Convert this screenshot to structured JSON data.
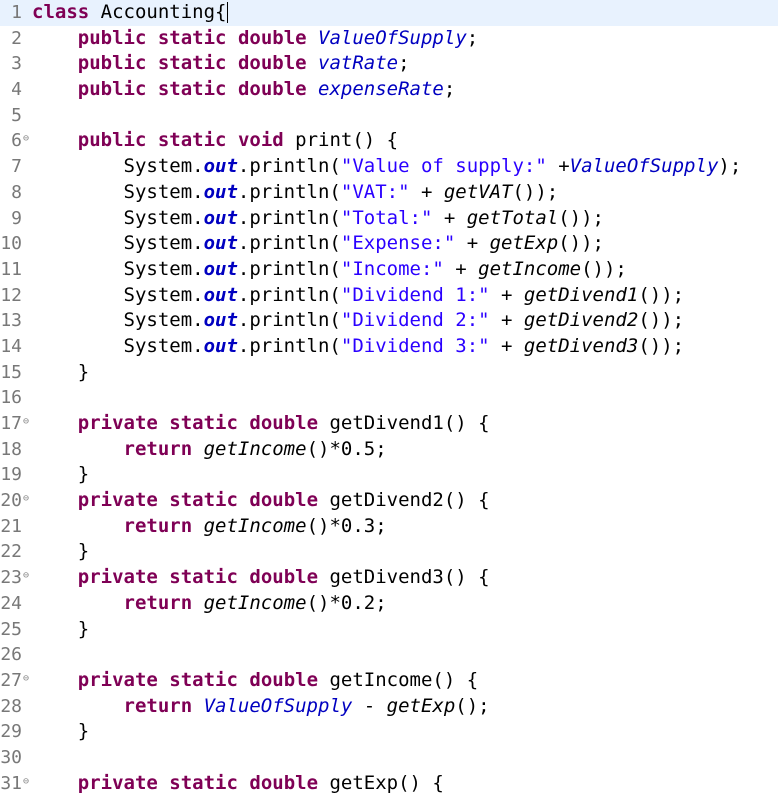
{
  "editor": {
    "lines": [
      {
        "n": "1",
        "fold": false,
        "current": true,
        "tokens": [
          {
            "t": "class",
            "s": "kw"
          },
          {
            "t": " Accounting{",
            "s": "plain"
          }
        ]
      },
      {
        "n": "2",
        "fold": false,
        "tokens": [
          {
            "t": "    ",
            "s": "plain"
          },
          {
            "t": "public",
            "s": "kw"
          },
          {
            "t": " ",
            "s": "plain"
          },
          {
            "t": "static",
            "s": "kw"
          },
          {
            "t": " ",
            "s": "plain"
          },
          {
            "t": "double",
            "s": "kw"
          },
          {
            "t": " ",
            "s": "plain"
          },
          {
            "t": "ValueOfSupply",
            "s": "field"
          },
          {
            "t": ";",
            "s": "plain"
          }
        ]
      },
      {
        "n": "3",
        "fold": false,
        "tokens": [
          {
            "t": "    ",
            "s": "plain"
          },
          {
            "t": "public",
            "s": "kw"
          },
          {
            "t": " ",
            "s": "plain"
          },
          {
            "t": "static",
            "s": "kw"
          },
          {
            "t": " ",
            "s": "plain"
          },
          {
            "t": "double",
            "s": "kw"
          },
          {
            "t": " ",
            "s": "plain"
          },
          {
            "t": "vatRate",
            "s": "field"
          },
          {
            "t": ";",
            "s": "plain"
          }
        ]
      },
      {
        "n": "4",
        "fold": false,
        "tokens": [
          {
            "t": "    ",
            "s": "plain"
          },
          {
            "t": "public",
            "s": "kw"
          },
          {
            "t": " ",
            "s": "plain"
          },
          {
            "t": "static",
            "s": "kw"
          },
          {
            "t": " ",
            "s": "plain"
          },
          {
            "t": "double",
            "s": "kw"
          },
          {
            "t": " ",
            "s": "plain"
          },
          {
            "t": "expenseRate",
            "s": "field"
          },
          {
            "t": ";",
            "s": "plain"
          }
        ]
      },
      {
        "n": "5",
        "fold": false,
        "tokens": []
      },
      {
        "n": "6",
        "fold": true,
        "tokens": [
          {
            "t": "    ",
            "s": "plain"
          },
          {
            "t": "public",
            "s": "kw"
          },
          {
            "t": " ",
            "s": "plain"
          },
          {
            "t": "static",
            "s": "kw"
          },
          {
            "t": " ",
            "s": "plain"
          },
          {
            "t": "void",
            "s": "kw"
          },
          {
            "t": " print() {",
            "s": "plain"
          }
        ]
      },
      {
        "n": "7",
        "fold": false,
        "tokens": [
          {
            "t": "        System.",
            "s": "plain"
          },
          {
            "t": "out",
            "s": "fieldbi"
          },
          {
            "t": ".println(",
            "s": "plain"
          },
          {
            "t": "\"Value of supply:\"",
            "s": "str"
          },
          {
            "t": " +",
            "s": "plain"
          },
          {
            "t": "ValueOfSupply",
            "s": "field"
          },
          {
            "t": ");",
            "s": "plain"
          }
        ]
      },
      {
        "n": "8",
        "fold": false,
        "tokens": [
          {
            "t": "        System.",
            "s": "plain"
          },
          {
            "t": "out",
            "s": "fieldbi"
          },
          {
            "t": ".println(",
            "s": "plain"
          },
          {
            "t": "\"VAT:\"",
            "s": "str"
          },
          {
            "t": " + ",
            "s": "plain"
          },
          {
            "t": "getVAT",
            "s": "itm"
          },
          {
            "t": "());",
            "s": "plain"
          }
        ]
      },
      {
        "n": "9",
        "fold": false,
        "tokens": [
          {
            "t": "        System.",
            "s": "plain"
          },
          {
            "t": "out",
            "s": "fieldbi"
          },
          {
            "t": ".println(",
            "s": "plain"
          },
          {
            "t": "\"Total:\"",
            "s": "str"
          },
          {
            "t": " + ",
            "s": "plain"
          },
          {
            "t": "getTotal",
            "s": "itm"
          },
          {
            "t": "());",
            "s": "plain"
          }
        ]
      },
      {
        "n": "10",
        "fold": false,
        "tokens": [
          {
            "t": "        System.",
            "s": "plain"
          },
          {
            "t": "out",
            "s": "fieldbi"
          },
          {
            "t": ".println(",
            "s": "plain"
          },
          {
            "t": "\"Expense:\"",
            "s": "str"
          },
          {
            "t": " + ",
            "s": "plain"
          },
          {
            "t": "getExp",
            "s": "itm"
          },
          {
            "t": "());",
            "s": "plain"
          }
        ]
      },
      {
        "n": "11",
        "fold": false,
        "tokens": [
          {
            "t": "        System.",
            "s": "plain"
          },
          {
            "t": "out",
            "s": "fieldbi"
          },
          {
            "t": ".println(",
            "s": "plain"
          },
          {
            "t": "\"Income:\"",
            "s": "str"
          },
          {
            "t": " + ",
            "s": "plain"
          },
          {
            "t": "getIncome",
            "s": "itm"
          },
          {
            "t": "());",
            "s": "plain"
          }
        ]
      },
      {
        "n": "12",
        "fold": false,
        "tokens": [
          {
            "t": "        System.",
            "s": "plain"
          },
          {
            "t": "out",
            "s": "fieldbi"
          },
          {
            "t": ".println(",
            "s": "plain"
          },
          {
            "t": "\"Dividend 1:\"",
            "s": "str"
          },
          {
            "t": " + ",
            "s": "plain"
          },
          {
            "t": "getDivend1",
            "s": "itm"
          },
          {
            "t": "());",
            "s": "plain"
          }
        ]
      },
      {
        "n": "13",
        "fold": false,
        "tokens": [
          {
            "t": "        System.",
            "s": "plain"
          },
          {
            "t": "out",
            "s": "fieldbi"
          },
          {
            "t": ".println(",
            "s": "plain"
          },
          {
            "t": "\"Dividend 2:\"",
            "s": "str"
          },
          {
            "t": " + ",
            "s": "plain"
          },
          {
            "t": "getDivend2",
            "s": "itm"
          },
          {
            "t": "());",
            "s": "plain"
          }
        ]
      },
      {
        "n": "14",
        "fold": false,
        "tokens": [
          {
            "t": "        System.",
            "s": "plain"
          },
          {
            "t": "out",
            "s": "fieldbi"
          },
          {
            "t": ".println(",
            "s": "plain"
          },
          {
            "t": "\"Dividend 3:\"",
            "s": "str"
          },
          {
            "t": " + ",
            "s": "plain"
          },
          {
            "t": "getDivend3",
            "s": "itm"
          },
          {
            "t": "());",
            "s": "plain"
          }
        ]
      },
      {
        "n": "15",
        "fold": false,
        "tokens": [
          {
            "t": "    }",
            "s": "plain"
          }
        ]
      },
      {
        "n": "16",
        "fold": false,
        "tokens": []
      },
      {
        "n": "17",
        "fold": true,
        "tokens": [
          {
            "t": "    ",
            "s": "plain"
          },
          {
            "t": "private",
            "s": "kw"
          },
          {
            "t": " ",
            "s": "plain"
          },
          {
            "t": "static",
            "s": "kw"
          },
          {
            "t": " ",
            "s": "plain"
          },
          {
            "t": "double",
            "s": "kw"
          },
          {
            "t": " getDivend1() {",
            "s": "plain"
          }
        ]
      },
      {
        "n": "18",
        "fold": false,
        "tokens": [
          {
            "t": "        ",
            "s": "plain"
          },
          {
            "t": "return",
            "s": "kw"
          },
          {
            "t": " ",
            "s": "plain"
          },
          {
            "t": "getIncome",
            "s": "itm"
          },
          {
            "t": "()*0.5;",
            "s": "plain"
          }
        ]
      },
      {
        "n": "19",
        "fold": false,
        "tokens": [
          {
            "t": "    }",
            "s": "plain"
          }
        ]
      },
      {
        "n": "20",
        "fold": true,
        "tokens": [
          {
            "t": "    ",
            "s": "plain"
          },
          {
            "t": "private",
            "s": "kw"
          },
          {
            "t": " ",
            "s": "plain"
          },
          {
            "t": "static",
            "s": "kw"
          },
          {
            "t": " ",
            "s": "plain"
          },
          {
            "t": "double",
            "s": "kw"
          },
          {
            "t": " getDivend2() {",
            "s": "plain"
          }
        ]
      },
      {
        "n": "21",
        "fold": false,
        "tokens": [
          {
            "t": "        ",
            "s": "plain"
          },
          {
            "t": "return",
            "s": "kw"
          },
          {
            "t": " ",
            "s": "plain"
          },
          {
            "t": "getIncome",
            "s": "itm"
          },
          {
            "t": "()*0.3;",
            "s": "plain"
          }
        ]
      },
      {
        "n": "22",
        "fold": false,
        "tokens": [
          {
            "t": "    }",
            "s": "plain"
          }
        ]
      },
      {
        "n": "23",
        "fold": true,
        "tokens": [
          {
            "t": "    ",
            "s": "plain"
          },
          {
            "t": "private",
            "s": "kw"
          },
          {
            "t": " ",
            "s": "plain"
          },
          {
            "t": "static",
            "s": "kw"
          },
          {
            "t": " ",
            "s": "plain"
          },
          {
            "t": "double",
            "s": "kw"
          },
          {
            "t": " getDivend3() {",
            "s": "plain"
          }
        ]
      },
      {
        "n": "24",
        "fold": false,
        "tokens": [
          {
            "t": "        ",
            "s": "plain"
          },
          {
            "t": "return",
            "s": "kw"
          },
          {
            "t": " ",
            "s": "plain"
          },
          {
            "t": "getIncome",
            "s": "itm"
          },
          {
            "t": "()*0.2;",
            "s": "plain"
          }
        ]
      },
      {
        "n": "25",
        "fold": false,
        "tokens": [
          {
            "t": "    }",
            "s": "plain"
          }
        ]
      },
      {
        "n": "26",
        "fold": false,
        "tokens": []
      },
      {
        "n": "27",
        "fold": true,
        "tokens": [
          {
            "t": "    ",
            "s": "plain"
          },
          {
            "t": "private",
            "s": "kw"
          },
          {
            "t": " ",
            "s": "plain"
          },
          {
            "t": "static",
            "s": "kw"
          },
          {
            "t": " ",
            "s": "plain"
          },
          {
            "t": "double",
            "s": "kw"
          },
          {
            "t": " getIncome() {",
            "s": "plain"
          }
        ]
      },
      {
        "n": "28",
        "fold": false,
        "tokens": [
          {
            "t": "        ",
            "s": "plain"
          },
          {
            "t": "return",
            "s": "kw"
          },
          {
            "t": " ",
            "s": "plain"
          },
          {
            "t": "ValueOfSupply",
            "s": "field"
          },
          {
            "t": " - ",
            "s": "plain"
          },
          {
            "t": "getExp",
            "s": "itm"
          },
          {
            "t": "();",
            "s": "plain"
          }
        ]
      },
      {
        "n": "29",
        "fold": false,
        "tokens": [
          {
            "t": "    }",
            "s": "plain"
          }
        ]
      },
      {
        "n": "30",
        "fold": false,
        "tokens": []
      },
      {
        "n": "31",
        "fold": true,
        "tokens": [
          {
            "t": "    ",
            "s": "plain"
          },
          {
            "t": "private",
            "s": "kw"
          },
          {
            "t": " ",
            "s": "plain"
          },
          {
            "t": "static",
            "s": "kw"
          },
          {
            "t": " ",
            "s": "plain"
          },
          {
            "t": "double",
            "s": "kw"
          },
          {
            "t": " getExp() {",
            "s": "plain"
          }
        ]
      }
    ],
    "fold_icon": "⊖"
  }
}
